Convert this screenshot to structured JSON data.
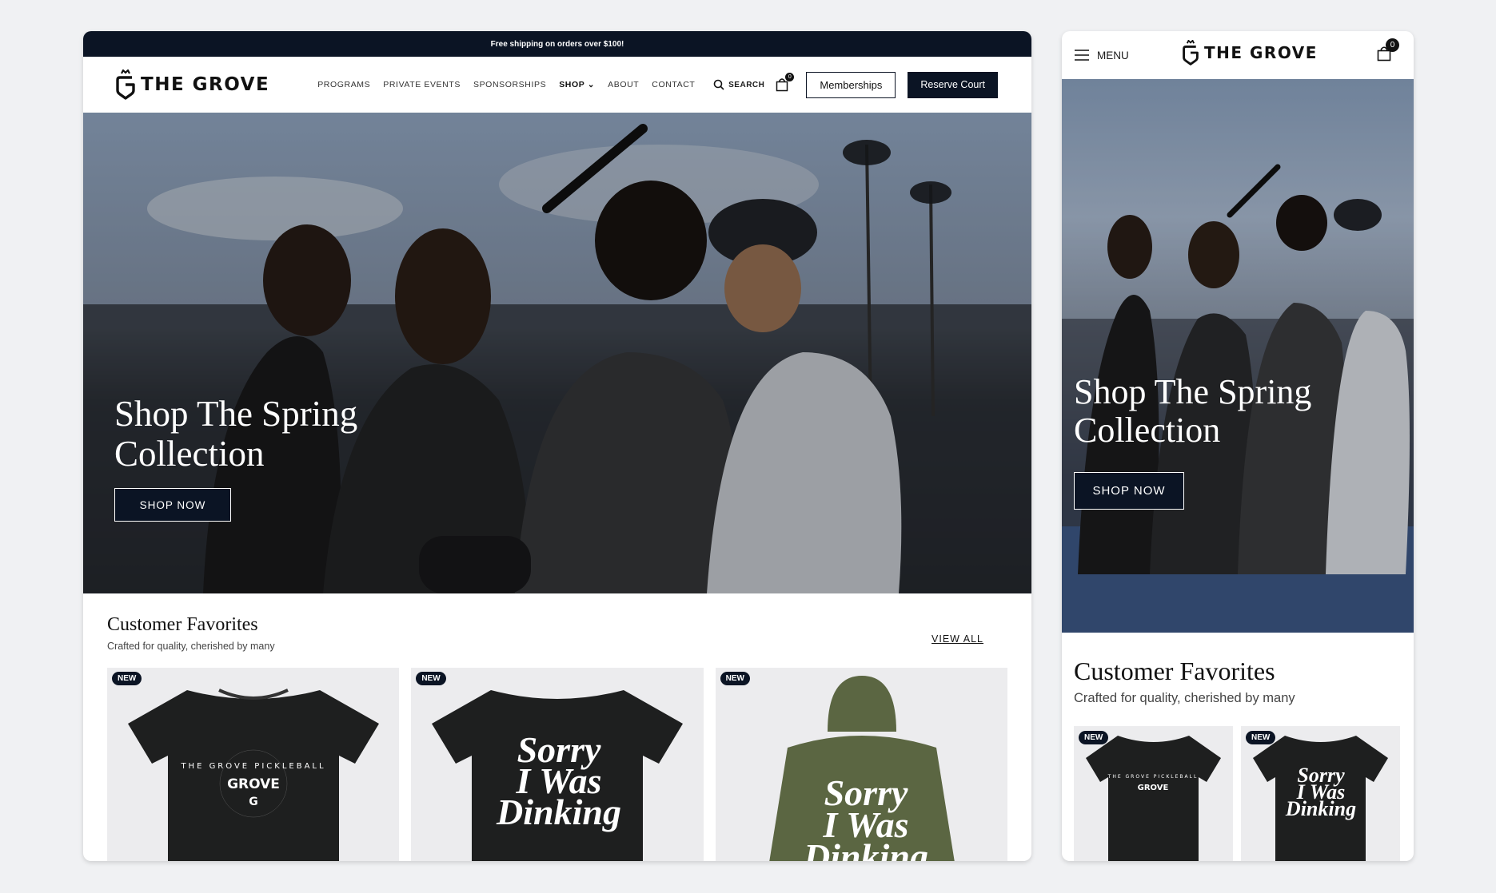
{
  "brand": {
    "name": "THE GROVE"
  },
  "desktop": {
    "promo": "Free shipping on orders over $100!",
    "nav": [
      "PROGRAMS",
      "PRIVATE EVENTS",
      "SPONSORSHIPS",
      "SHOP",
      "ABOUT",
      "CONTACT"
    ],
    "search_label": "SEARCH",
    "cart_count": "0",
    "memberships_label": "Memberships",
    "reserve_label": "Reserve Court",
    "hero": {
      "title": "Shop The Spring Collection",
      "cta": "SHOP NOW"
    },
    "favorites": {
      "title": "Customer Favorites",
      "subtitle": "Crafted for quality, cherished by many",
      "view_all": "VIEW ALL",
      "badge": "NEW"
    }
  },
  "mobile": {
    "menu_label": "MENU",
    "cart_count": "0",
    "hero": {
      "title": "Shop The Spring Collection",
      "cta": "SHOP NOW"
    },
    "favorites": {
      "title": "Customer Favorites",
      "subtitle": "Crafted for quality, cherished by many",
      "badge": "NEW"
    }
  },
  "products": {
    "circle_text": "THE GROVE PICKLEBALL",
    "center_text": "GROVE",
    "slogan": [
      "Sorry",
      "I Was",
      "Dinking"
    ]
  },
  "colors": {
    "navy": "#0b1424",
    "hoodie": "#5b6642",
    "shirt": "#1e1f1f",
    "card_bg": "#ececee"
  }
}
